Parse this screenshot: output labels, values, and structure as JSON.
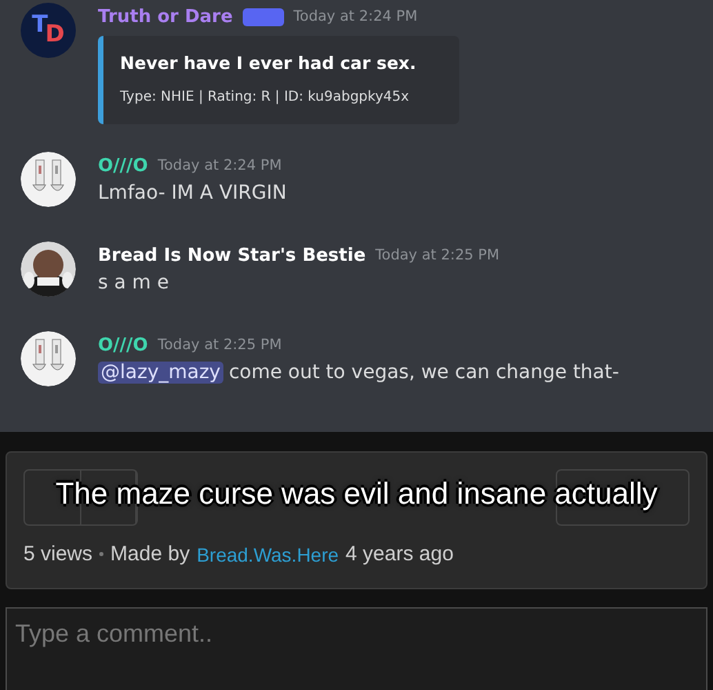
{
  "chat": {
    "messages": [
      {
        "kind": "embed",
        "author": "Truth or Dare",
        "color": "#a97ff0",
        "bot": true,
        "time": "Today at 2:24 PM",
        "avatar_letters": [
          {
            "text": "T",
            "color": "#5b7cf7"
          },
          {
            "text": "D",
            "color": "#e5474d"
          }
        ],
        "embed": {
          "title": "Never have I ever had car sex.",
          "footer": "Type: NHIE | Rating: R | ID: ku9abgpky45x"
        }
      },
      {
        "kind": "text",
        "author": "O///O",
        "color": "#3fd6ae",
        "time": "Today at 2:24 PM",
        "text": "Lmfao- IM A VIRGIN"
      },
      {
        "kind": "text",
        "author": "Bread Is Now Star's Bestie",
        "color": "#ffffff",
        "time": "Today at 2:25 PM",
        "text": "s a m e"
      },
      {
        "kind": "mention",
        "author": "O///O",
        "color": "#3fd6ae",
        "time": "Today at 2:25 PM",
        "mention": "@lazy_mazy",
        "text": "come out to vegas, we can change that-"
      }
    ]
  },
  "meme": {
    "caption": "The maze curse was evil and insane actually",
    "views": "5 views",
    "made_by": "Made by",
    "user": "Bread.Was.Here",
    "age": "4 years ago"
  },
  "comment": {
    "placeholder": "Type a comment.."
  }
}
